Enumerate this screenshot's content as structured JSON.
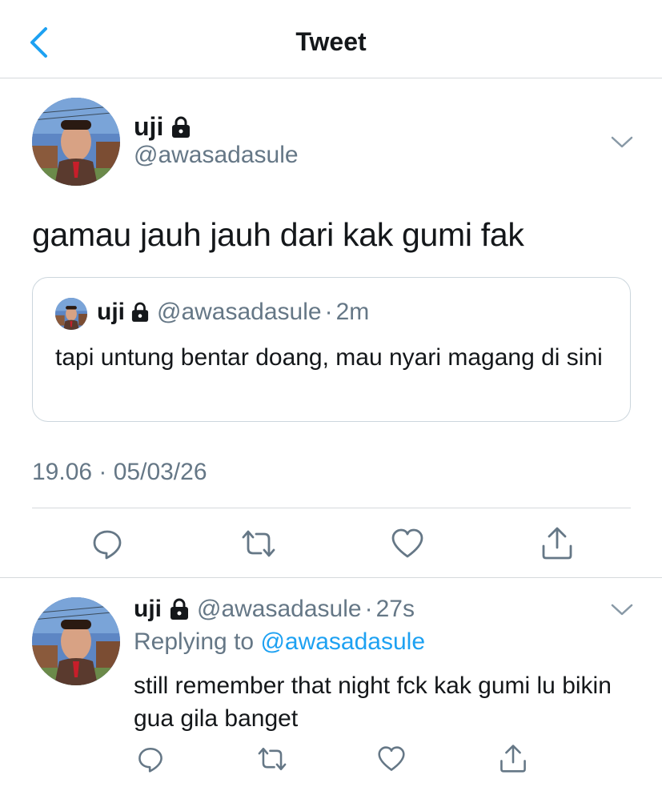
{
  "header": {
    "title": "Tweet",
    "back_icon": "chevron-left-icon"
  },
  "colors": {
    "accent": "#1da1f2",
    "secondary_text": "#657786",
    "divider": "#d6d9dc"
  },
  "tweet": {
    "display_name": "uji",
    "protected_icon": "lock-icon",
    "handle": "@awasadasule",
    "text": "gamau jauh jauh dari kak gumi fak",
    "timestamp": "19.06 · 05/03/26",
    "actions": [
      "reply-icon",
      "retweet-icon",
      "like-icon",
      "share-icon"
    ]
  },
  "quoted_tweet": {
    "display_name": "uji",
    "handle": "@awasadasule",
    "separator": "·",
    "time": "2m",
    "text": "tapi untung bentar doang, mau nyari magang di sini"
  },
  "reply": {
    "display_name": "uji",
    "handle": "@awasadasule",
    "separator": "·",
    "time": "27s",
    "replying_to_label": "Replying to",
    "replying_to_handle": "@awasadasule",
    "text": "still remember that night fck kak gumi lu bikin gua gila banget",
    "actions": [
      "reply-icon",
      "retweet-icon",
      "like-icon",
      "share-icon"
    ]
  }
}
